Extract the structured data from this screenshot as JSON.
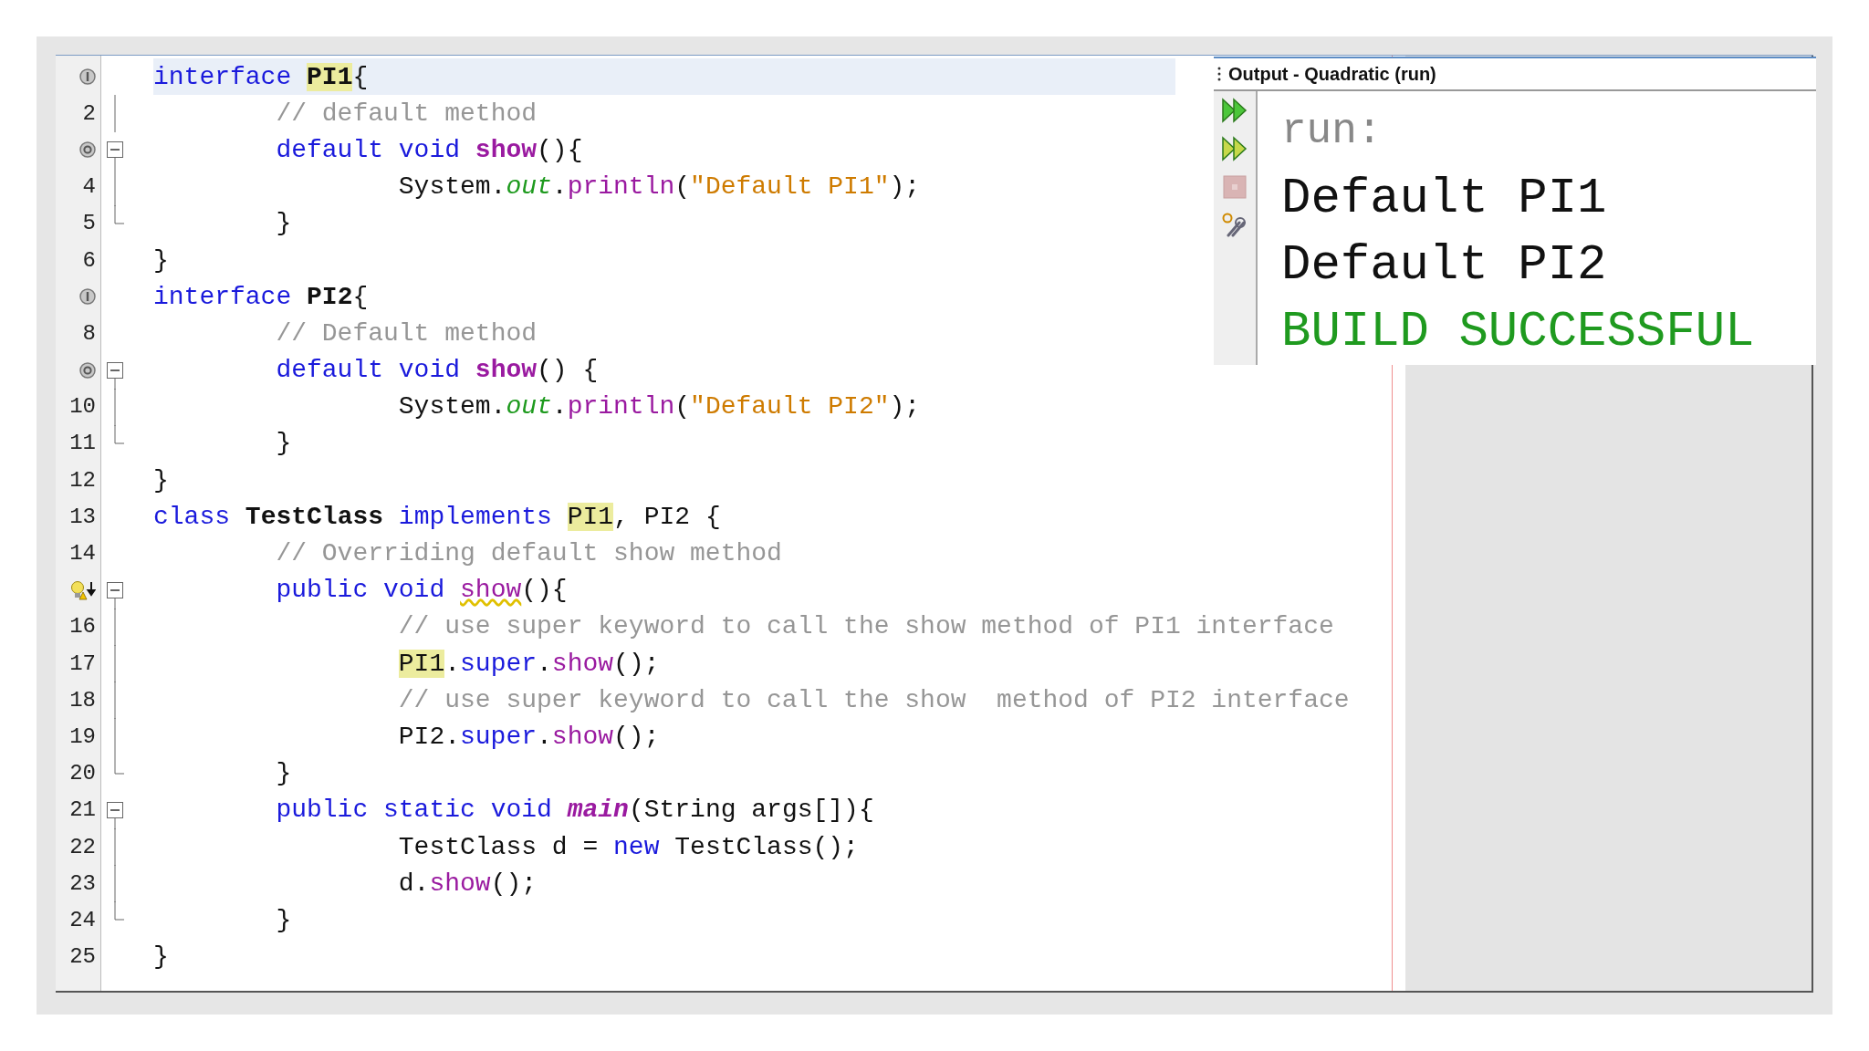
{
  "editor": {
    "lines": [
      {
        "gutter_icon": {
          "kind": "interface"
        },
        "current": true,
        "tokens": [
          {
            "text": "interface ",
            "kind": "keyword"
          },
          {
            "text": "PI1",
            "kind": "decl-occurrence"
          },
          {
            "text": "{",
            "kind": "plain"
          }
        ],
        "children": [
          {
            "number": "2",
            "fold": {
              "kind": "middle"
            },
            "current": false,
            "tokens": [
              {
                "text": "// default method",
                "kind": "comment"
              }
            ]
          },
          {
            "gutter_icon": {
              "kind": "override"
            },
            "fold": {
              "kind": "start"
            },
            "current": false,
            "tokens": [
              {
                "text": "default void ",
                "kind": "keyword"
              },
              {
                "text": "show",
                "kind": "method-decl"
              },
              {
                "text": "(){",
                "kind": "plain"
              }
            ],
            "children": [
              {
                "number": "4",
                "fold": {
                  "kind": "middle"
                },
                "current": false,
                "tokens": [
                  {
                    "text": "System.",
                    "kind": "plain"
                  },
                  {
                    "text": "out",
                    "kind": "field"
                  },
                  {
                    "text": ".",
                    "kind": "plain"
                  },
                  {
                    "text": "println",
                    "kind": "method"
                  },
                  {
                    "text": "(",
                    "kind": "plain"
                  },
                  {
                    "text": "\"Default PI1\"",
                    "kind": "string"
                  },
                  {
                    "text": ");",
                    "kind": "plain"
                  }
                ]
              }
            ]
          },
          {
            "number": "5",
            "fold": {
              "kind": "end"
            },
            "current": false,
            "tokens": [
              {
                "text": "}",
                "kind": "plain"
              }
            ]
          }
        ]
      },
      {
        "number": "6",
        "current": false,
        "tokens": [
          {
            "text": "}",
            "kind": "plain"
          }
        ]
      },
      {
        "gutter_icon": {
          "kind": "interface"
        },
        "current": false,
        "tokens": [
          {
            "text": "interface ",
            "kind": "keyword"
          },
          {
            "text": "PI2",
            "kind": "decl"
          },
          {
            "text": "{",
            "kind": "plain"
          }
        ],
        "children": [
          {
            "number": "8",
            "current": false,
            "tokens": [
              {
                "text": "// Default method",
                "kind": "comment"
              }
            ]
          },
          {
            "gutter_icon": {
              "kind": "override"
            },
            "fold": {
              "kind": "start"
            },
            "current": false,
            "tokens": [
              {
                "text": "default void ",
                "kind": "keyword"
              },
              {
                "text": "show",
                "kind": "method-decl"
              },
              {
                "text": "() {",
                "kind": "plain"
              }
            ],
            "children": [
              {
                "number": "10",
                "fold": {
                  "kind": "middle"
                },
                "current": false,
                "tokens": [
                  {
                    "text": "System.",
                    "kind": "plain"
                  },
                  {
                    "text": "out",
                    "kind": "field"
                  },
                  {
                    "text": ".",
                    "kind": "plain"
                  },
                  {
                    "text": "println",
                    "kind": "method"
                  },
                  {
                    "text": "(",
                    "kind": "plain"
                  },
                  {
                    "text": "\"Default PI2\"",
                    "kind": "string"
                  },
                  {
                    "text": ");",
                    "kind": "plain"
                  }
                ]
              }
            ]
          },
          {
            "number": "11",
            "fold": {
              "kind": "end"
            },
            "current": false,
            "tokens": [
              {
                "text": "}",
                "kind": "plain"
              }
            ]
          }
        ]
      },
      {
        "number": "12",
        "current": false,
        "tokens": [
          {
            "text": "}",
            "kind": "plain"
          }
        ]
      },
      {
        "number": "13",
        "current": false,
        "tokens": [
          {
            "text": "class ",
            "kind": "keyword"
          },
          {
            "text": "TestClass",
            "kind": "decl"
          },
          {
            "text": " implements ",
            "kind": "keyword"
          },
          {
            "text": "PI1",
            "kind": "occurrence"
          },
          {
            "text": ", PI2 {",
            "kind": "plain"
          }
        ],
        "children": [
          {
            "number": "14",
            "current": false,
            "tokens": [
              {
                "text": "// Overriding default show method",
                "kind": "comment"
              }
            ]
          },
          {
            "gutter_icon": {
              "kind": "hint"
            },
            "fold": {
              "kind": "start"
            },
            "current": false,
            "tokens": [
              {
                "text": "public void ",
                "kind": "keyword"
              },
              {
                "text": "show",
                "kind": "method-warn"
              },
              {
                "text": "(){",
                "kind": "plain"
              }
            ],
            "children": [
              {
                "number": "16",
                "fold": {
                  "kind": "middle"
                },
                "current": false,
                "tokens": [
                  {
                    "text": "// use super keyword to call the show method of PI1 interface",
                    "kind": "comment"
                  }
                ]
              },
              {
                "number": "17",
                "fold": {
                  "kind": "middle"
                },
                "current": false,
                "tokens": [
                  {
                    "text": "PI1",
                    "kind": "occurrence"
                  },
                  {
                    "text": ".",
                    "kind": "plain"
                  },
                  {
                    "text": "super",
                    "kind": "keyword"
                  },
                  {
                    "text": ".",
                    "kind": "plain"
                  },
                  {
                    "text": "show",
                    "kind": "method"
                  },
                  {
                    "text": "();",
                    "kind": "plain"
                  }
                ]
              },
              {
                "number": "18",
                "fold": {
                  "kind": "middle"
                },
                "current": false,
                "tokens": [
                  {
                    "text": "// use super keyword to call the show  method of PI2 interface",
                    "kind": "comment"
                  }
                ]
              },
              {
                "number": "19",
                "fold": {
                  "kind": "middle"
                },
                "current": false,
                "tokens": [
                  {
                    "text": "PI2.",
                    "kind": "plain"
                  },
                  {
                    "text": "super",
                    "kind": "keyword"
                  },
                  {
                    "text": ".",
                    "kind": "plain"
                  },
                  {
                    "text": "show",
                    "kind": "method"
                  },
                  {
                    "text": "();",
                    "kind": "plain"
                  }
                ]
              }
            ]
          },
          {
            "number": "20",
            "fold": {
              "kind": "end"
            },
            "current": false,
            "tokens": [
              {
                "text": "}",
                "kind": "plain"
              }
            ]
          },
          {
            "number": "21",
            "fold": {
              "kind": "start"
            },
            "current": false,
            "tokens": [
              {
                "text": "public static void ",
                "kind": "keyword"
              },
              {
                "text": "main",
                "kind": "static-method-decl"
              },
              {
                "text": "(String args[]){",
                "kind": "plain"
              }
            ],
            "children": [
              {
                "number": "22",
                "fold": {
                  "kind": "middle"
                },
                "current": false,
                "tokens": [
                  {
                    "text": "TestClass d = ",
                    "kind": "plain"
                  },
                  {
                    "text": "new",
                    "kind": "keyword"
                  },
                  {
                    "text": " TestClass();",
                    "kind": "plain"
                  }
                ]
              },
              {
                "number": "23",
                "fold": {
                  "kind": "middle"
                },
                "current": false,
                "tokens": [
                  {
                    "text": "d.",
                    "kind": "plain"
                  },
                  {
                    "text": "show",
                    "kind": "method"
                  },
                  {
                    "text": "();",
                    "kind": "plain"
                  }
                ]
              }
            ]
          },
          {
            "number": "24",
            "fold": {
              "kind": "end"
            },
            "current": false,
            "tokens": [
              {
                "text": "}",
                "kind": "plain"
              }
            ]
          }
        ]
      },
      {
        "number": "25",
        "current": false,
        "tokens": [
          {
            "text": "}",
            "kind": "plain"
          }
        ]
      }
    ]
  },
  "output": {
    "title": "Output - Quadratic (run)",
    "toolbar": [
      {
        "kind": "rerun",
        "disabled": false
      },
      {
        "kind": "rerun-options",
        "disabled": false
      },
      {
        "kind": "stop",
        "disabled": true
      },
      {
        "kind": "settings",
        "disabled": false
      }
    ],
    "lines": [
      {
        "text": "run:",
        "kind": "info"
      },
      {
        "text": "Default PI1",
        "kind": "normal"
      },
      {
        "text": "Default PI2",
        "kind": "normal"
      },
      {
        "text": "BUILD SUCCESSFUL",
        "kind": "success"
      }
    ]
  }
}
